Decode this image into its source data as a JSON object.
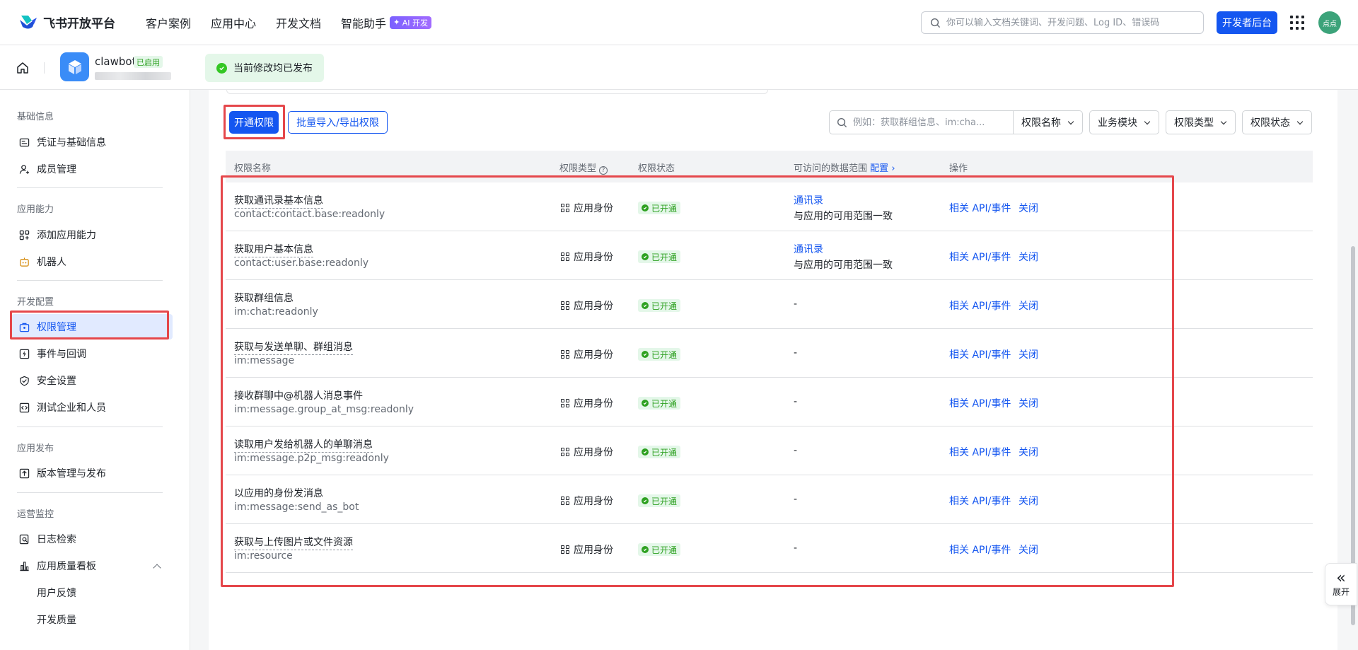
{
  "brand": {
    "name": "飞书开放平台"
  },
  "topnav": {
    "links": [
      "客户案例",
      "应用中心",
      "开发文档",
      "智能助手"
    ],
    "ai_badge": "AI 开发",
    "search_placeholder": "你可以输入文档关键词、开发问题、Log ID、错误码",
    "dev_console": "开发者后台",
    "avatar_text": "点点"
  },
  "app": {
    "name": "clawbot",
    "status_tag": "已启用",
    "publish_status": "当前修改均已发布"
  },
  "sidebar": {
    "sections": [
      {
        "title": "基础信息",
        "items": [
          {
            "label": "凭证与基础信息",
            "icon": "credential-icon"
          },
          {
            "label": "成员管理",
            "icon": "member-icon"
          }
        ]
      },
      {
        "title": "应用能力",
        "items": [
          {
            "label": "添加应用能力",
            "icon": "add-capability-icon"
          },
          {
            "label": "机器人",
            "icon": "robot-icon"
          }
        ]
      },
      {
        "title": "开发配置",
        "items": [
          {
            "label": "权限管理",
            "icon": "permission-icon",
            "active": true
          },
          {
            "label": "事件与回调",
            "icon": "event-icon"
          },
          {
            "label": "安全设置",
            "icon": "shield-icon"
          },
          {
            "label": "测试企业和人员",
            "icon": "code-icon"
          }
        ]
      },
      {
        "title": "应用发布",
        "items": [
          {
            "label": "版本管理与发布",
            "icon": "upload-icon"
          }
        ]
      },
      {
        "title": "运营监控",
        "items": [
          {
            "label": "日志检索",
            "icon": "log-search-icon"
          },
          {
            "label": "应用质量看板",
            "icon": "chart-icon"
          },
          {
            "label": "用户反馈"
          },
          {
            "label": "开发质量"
          }
        ]
      }
    ]
  },
  "toolbar": {
    "open_permission": "开通权限",
    "batch": "批量导入/导出权限",
    "search_placeholder": "例如：获取群组信息、im:cha...",
    "filters": [
      "权限名称",
      "业务模块",
      "权限类型",
      "权限状态"
    ]
  },
  "table": {
    "headers": {
      "name": "权限名称",
      "type": "权限类型",
      "status": "权限状态",
      "scope": "可访问的数据范围",
      "scope_config": "配置",
      "ops": "操作"
    },
    "rows": [
      {
        "name": "获取通讯录基本信息",
        "code": "contact:contact.base:readonly",
        "type": "应用身份",
        "status": "已开通",
        "scope": [
          "通讯录",
          "与应用的可用范围一致"
        ],
        "op1": "相关 API/事件",
        "op2": "关闭"
      },
      {
        "name": "获取用户基本信息",
        "code": "contact:user.base:readonly",
        "type": "应用身份",
        "status": "已开通",
        "scope": [
          "通讯录",
          "与应用的可用范围一致"
        ],
        "op1": "相关 API/事件",
        "op2": "关闭"
      },
      {
        "name": "获取群组信息",
        "code": "im:chat:readonly",
        "type": "应用身份",
        "status": "已开通",
        "scope": [
          "-"
        ],
        "op1": "相关 API/事件",
        "op2": "关闭"
      },
      {
        "name": "获取与发送单聊、群组消息",
        "code": "im:message",
        "type": "应用身份",
        "status": "已开通",
        "scope": [
          "-"
        ],
        "op1": "相关 API/事件",
        "op2": "关闭"
      },
      {
        "name": "接收群聊中@机器人消息事件",
        "code": "im:message.group_at_msg:readonly",
        "type": "应用身份",
        "status": "已开通",
        "scope": [
          "-"
        ],
        "op1": "相关 API/事件",
        "op2": "关闭"
      },
      {
        "name": "读取用户发给机器人的单聊消息",
        "code": "im:message.p2p_msg:readonly",
        "type": "应用身份",
        "status": "已开通",
        "scope": [
          "-"
        ],
        "op1": "相关 API/事件",
        "op2": "关闭"
      },
      {
        "name": "以应用的身份发消息",
        "code": "im:message:send_as_bot",
        "type": "应用身份",
        "status": "已开通",
        "scope": [
          "-"
        ],
        "op1": "相关 API/事件",
        "op2": "关闭"
      },
      {
        "name": "获取与上传图片或文件资源",
        "code": "im:resource",
        "type": "应用身份",
        "status": "已开通",
        "scope": [
          "-"
        ],
        "op1": "相关 API/事件",
        "op2": "关闭"
      }
    ]
  },
  "expand_label": "展开",
  "colors": {
    "primary": "#1456f0",
    "success": "#2ea121",
    "highlight": "#e5474b"
  }
}
